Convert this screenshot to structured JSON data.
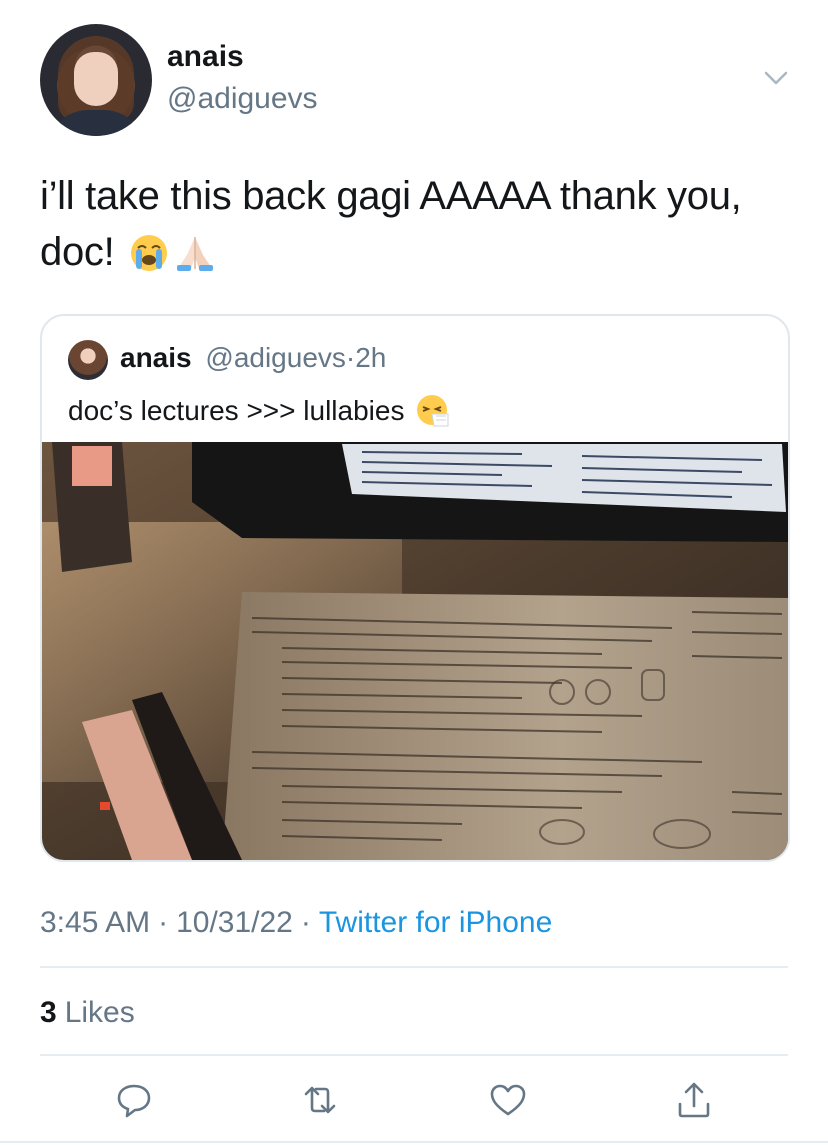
{
  "author": {
    "display_name": "anais",
    "handle": "@adiguevs"
  },
  "tweet": {
    "text": "i’ll take this back gagi AAAAA thank you, doc!",
    "emojis": [
      "loudly-crying-face-emoji",
      "folded-hands-emoji"
    ]
  },
  "quoted_tweet": {
    "display_name": "anais",
    "handle": "@adiguevs",
    "separator": "·",
    "time": "2h",
    "text": "doc’s lectures >>> lullabies",
    "emoji": "sneezing-face-emoji",
    "photo": "desk-lecture-notes-photo"
  },
  "meta": {
    "time": "3:45 AM",
    "separator": "·",
    "date": "10/31/22",
    "source": "Twitter for iPhone"
  },
  "stats": {
    "likes_count": "3",
    "likes_label": "Likes"
  },
  "actions": [
    "reply-icon",
    "retweet-icon",
    "like-icon",
    "share-icon"
  ],
  "colors": {
    "link": "#1b95e0",
    "secondary_text": "#657786",
    "divider": "#e6ecf0"
  }
}
